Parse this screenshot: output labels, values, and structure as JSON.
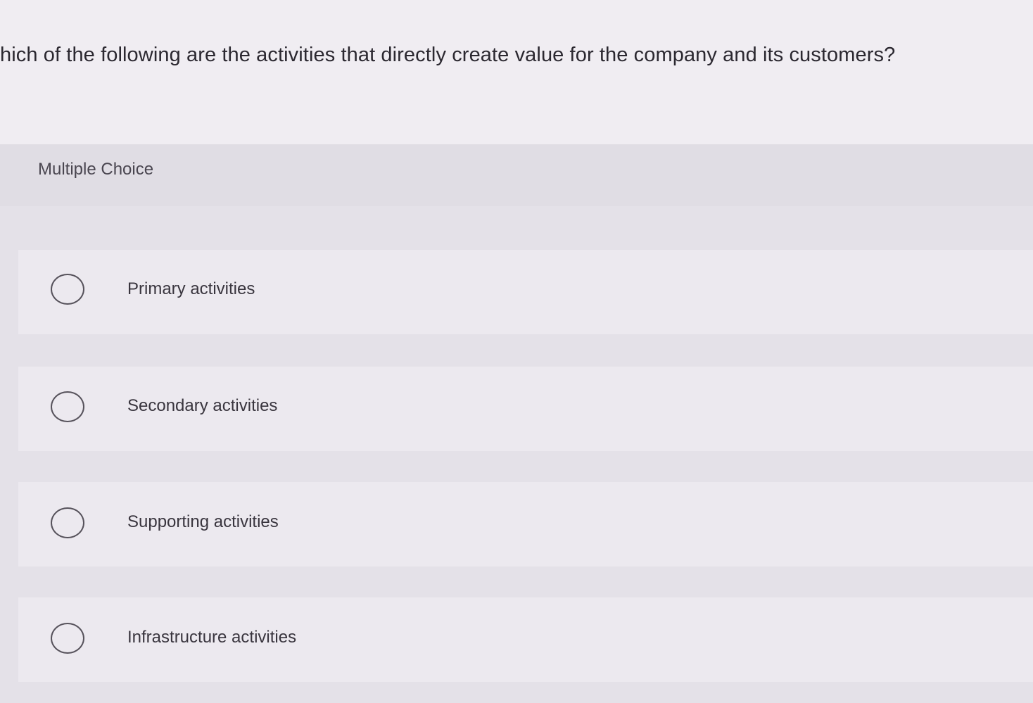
{
  "question": {
    "text": "hich of the following are the activities that directly create value for the company and its customers?"
  },
  "multiple_choice": {
    "label": "Multiple Choice",
    "options": [
      {
        "label": "Primary activities",
        "selected": false
      },
      {
        "label": "Secondary activities",
        "selected": false
      },
      {
        "label": "Supporting activities",
        "selected": false
      },
      {
        "label": "Infrastructure activities",
        "selected": false
      }
    ]
  }
}
